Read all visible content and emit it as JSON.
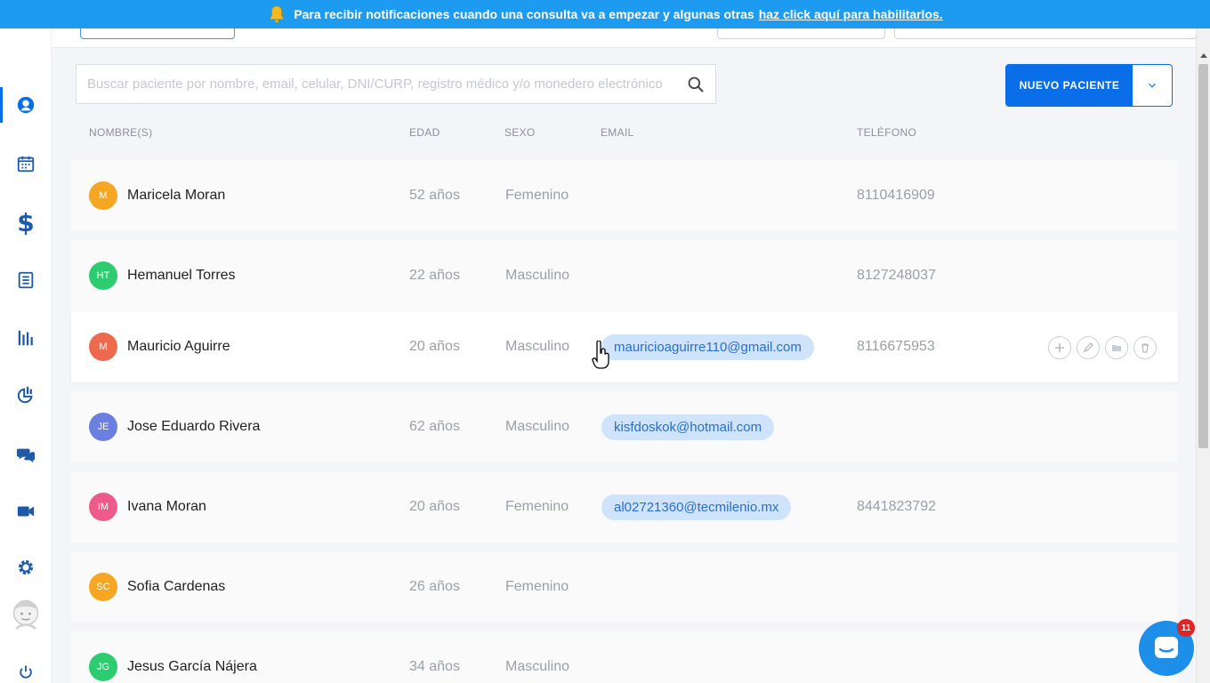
{
  "banner": {
    "text": "Para recibir notificaciones cuando una consulta va a empezar y algunas otras",
    "link": "haz click aquí para habilitarlos."
  },
  "sidebar": {
    "items": [
      {
        "icon": "patients-icon",
        "active": true
      },
      {
        "icon": "calendar-icon"
      },
      {
        "icon": "dollar-icon",
        "glyph": "$"
      },
      {
        "icon": "list-document-icon"
      },
      {
        "icon": "bar-chart-icon"
      },
      {
        "icon": "marketing-chart-icon"
      },
      {
        "icon": "chat-bubbles-icon"
      },
      {
        "icon": "video-camera-icon"
      },
      {
        "icon": "gear-icon"
      },
      {
        "icon": "user-avatar-icon"
      },
      {
        "icon": "power-icon"
      }
    ]
  },
  "search": {
    "placeholder": "Buscar paciente por nombre, email, celular, DNI/CURP, registro médico y/o monedero electrónico",
    "value": ""
  },
  "new_patient": {
    "label": "NUEVO PACIENTE"
  },
  "table": {
    "headers": {
      "name": "NOMBRE(S)",
      "age": "EDAD",
      "sex": "SEXO",
      "email": "EMAIL",
      "phone": "TELÉFONO"
    },
    "rows": [
      {
        "initials": "M",
        "color": "#f5a623",
        "name": "Maricela Moran",
        "age": "52 años",
        "sex": "Femenino",
        "email": "",
        "phone": "8110416909"
      },
      {
        "initials": "HT",
        "color": "#2ecc71",
        "name": "Hemanuel Torres",
        "age": "22 años",
        "sex": "Masculino",
        "email": "",
        "phone": "8127248037"
      },
      {
        "initials": "M",
        "color": "#ee6a4f",
        "name": "Mauricio Aguirre",
        "age": "20 años",
        "sex": "Masculino",
        "email": "mauricioaguirre110@gmail.com",
        "phone": "8116675953",
        "hovered": true
      },
      {
        "initials": "JE",
        "color": "#6a7fe0",
        "name": "Jose Eduardo Rivera",
        "age": "62 años",
        "sex": "Masculino",
        "email": "kisfdoskok@hotmail.com",
        "phone": ""
      },
      {
        "initials": "IM",
        "color": "#ee5b8a",
        "name": "Ivana Moran",
        "age": "20 años",
        "sex": "Femenino",
        "email": "al02721360@tecmilenio.mx",
        "phone": "8441823792"
      },
      {
        "initials": "SC",
        "color": "#f5a623",
        "name": "Sofia Cardenas",
        "age": "26 años",
        "sex": "Femenino",
        "email": "",
        "phone": ""
      },
      {
        "initials": "JG",
        "color": "#2ecc71",
        "name": "Jesus García Nájera",
        "age": "34 años",
        "sex": "Masculino",
        "email": "",
        "phone": ""
      }
    ]
  },
  "chat": {
    "badge": "11"
  },
  "colors": {
    "primary": "#0a6ee8",
    "banner": "#1d9bf0",
    "pill_bg": "#cfe3fb",
    "pill_text": "#2a6fc9"
  }
}
